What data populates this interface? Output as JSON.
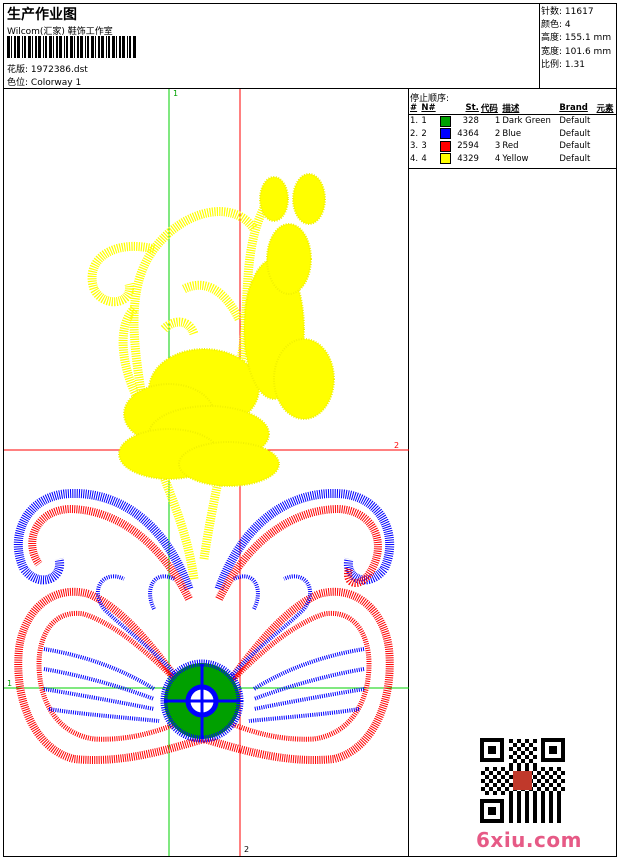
{
  "header": {
    "title": "生产作业图",
    "company": "Wilcom(汇家) 鞋饰工作室",
    "pattern_label": "花版:",
    "pattern_value": "1972386.dst",
    "color_label": "色位:",
    "color_value": "Colorway 1"
  },
  "stats": [
    {
      "label": "针数:",
      "value": "11617"
    },
    {
      "label": "颜色:",
      "value": "4"
    },
    {
      "label": "高度:",
      "value": "155.1 mm"
    },
    {
      "label": "宽度:",
      "value": "101.6 mm"
    },
    {
      "label": "比例:",
      "value": "1.31"
    }
  ],
  "stop_sequence": {
    "title": "停止顺序:",
    "columns": [
      "#",
      "N#",
      "St.",
      "代码",
      "描述",
      "Brand",
      "元素"
    ],
    "rows": [
      {
        "n": "1.",
        "num": "1",
        "color": "#00a000",
        "st": "328",
        "code": "1",
        "desc": "Dark Green",
        "brand": "Default"
      },
      {
        "n": "2.",
        "num": "2",
        "color": "#0000ff",
        "st": "4364",
        "code": "2",
        "desc": "Blue",
        "brand": "Default"
      },
      {
        "n": "3.",
        "num": "3",
        "color": "#ff0000",
        "st": "2594",
        "code": "3",
        "desc": "Red",
        "brand": "Default"
      },
      {
        "n": "4.",
        "num": "4",
        "color": "#ffff00",
        "st": "4329",
        "code": "4",
        "desc": "Yellow",
        "brand": "Default"
      }
    ]
  },
  "guides": {
    "v1": "1",
    "v2": "2",
    "h1": "1",
    "h2": "2"
  },
  "watermark": "6xiu.com"
}
